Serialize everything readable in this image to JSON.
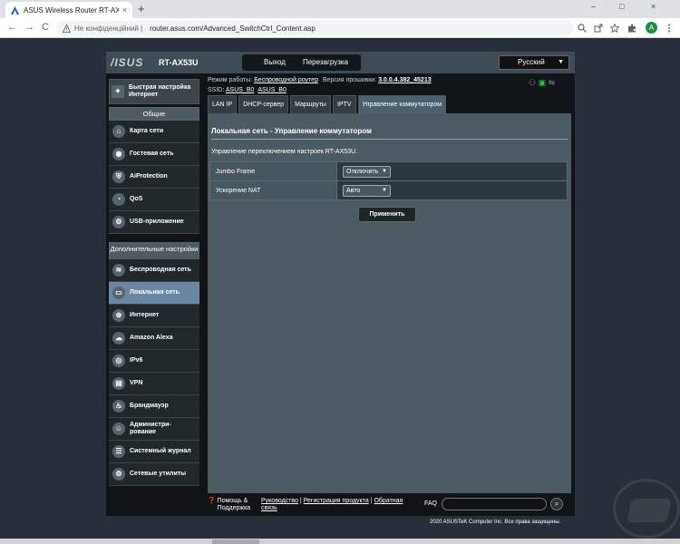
{
  "browser": {
    "tab_title": "ASUS Wireless Router RT-AX53U",
    "tab_close": "×",
    "new_tab": "+",
    "win_min": "–",
    "win_max": "□",
    "win_close": "×",
    "back": "←",
    "forward": "→",
    "reload": "C",
    "security_label": "Не конфіденційний",
    "url": "router.asus.com/Advanced_SwitchCtrl_Content.asp",
    "profile_initial": "A",
    "icons": [
      "warning-icon",
      "zoom-icon",
      "share-icon",
      "star-icon",
      "extensions-icon",
      "profile-icon",
      "menu-icon"
    ]
  },
  "router": {
    "brand": "/ISUS",
    "model": "RT-AX53U",
    "logout_label": "Выход",
    "reboot_label": "Перезагрузка",
    "language": "Русский",
    "mode_label": "Режим работы:",
    "mode_value": "Беспроводной роутер",
    "firmware_label": "Версия прошивки:",
    "firmware_value": "3.0.0.4.382_45213",
    "ssid_label": "SSID:",
    "ssid_1": "ASUS_B0",
    "ssid_2": "ASUS_B0"
  },
  "sidebar": {
    "quick_setup": "Быстрая настройка Интернет",
    "general_header": "Общие",
    "general_items": [
      {
        "label": "Карта сети",
        "icon": "network-map-icon"
      },
      {
        "label": "Гостевая сеть",
        "icon": "guest-network-icon"
      },
      {
        "label": "AiProtection",
        "icon": "shield-icon"
      },
      {
        "label": "QoS",
        "icon": "qos-icon"
      },
      {
        "label": "USB-приложение",
        "icon": "usb-icon"
      }
    ],
    "advanced_header": "Дополнительные настройки",
    "advanced_items": [
      {
        "label": "Беспроводная сеть",
        "icon": "wifi-icon"
      },
      {
        "label": "Локальная сеть",
        "icon": "lan-icon"
      },
      {
        "label": "Интернет",
        "icon": "globe-icon"
      },
      {
        "label": "Amazon Alexa",
        "icon": "alexa-icon"
      },
      {
        "label": "IPv6",
        "icon": "ipv6-icon"
      },
      {
        "label": "VPN",
        "icon": "vpn-icon"
      },
      {
        "label": "Брандмауэр",
        "icon": "firewall-icon"
      },
      {
        "label": "Администри-рование",
        "icon": "admin-icon"
      },
      {
        "label": "Системный журнал",
        "icon": "log-icon"
      },
      {
        "label": "Сетевые утилиты",
        "icon": "tools-icon"
      }
    ]
  },
  "tabs": [
    "LAN IP",
    "DHCP-сервер",
    "Маршруты",
    "IPTV",
    "Управление коммутатором"
  ],
  "content": {
    "title": "Локальная сеть - Управление коммутатором",
    "description": "Управление переключением настроек RT-AX53U.",
    "rows": [
      {
        "label": "Jumbo Frame",
        "value": "Отключить"
      },
      {
        "label": "Ускорение NAT",
        "value": "Авто"
      }
    ],
    "apply_label": "Применить"
  },
  "footer": {
    "help": "Помощь & Поддержка",
    "links": [
      "Руководство",
      "Регистрация продукта",
      "Обратная связь"
    ],
    "faq": "FAQ",
    "copyright": "2020 ASUSTeK Computer Inc. Все права защищены."
  },
  "colors": {
    "page_bg": "#27303a",
    "header_bg": "#3e4d55",
    "content_bg": "#4c5b63",
    "active_menu": "#6b86a2"
  }
}
